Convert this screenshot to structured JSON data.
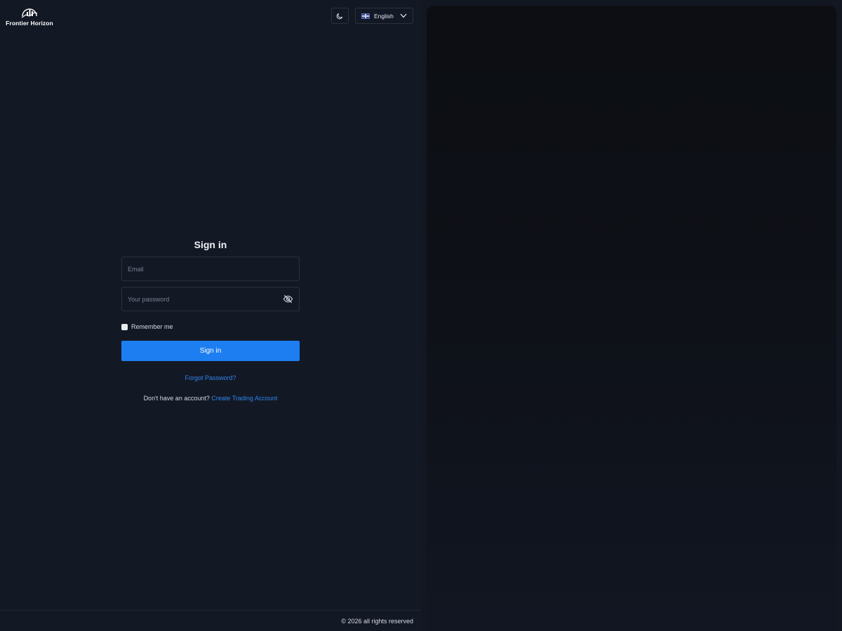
{
  "brand": {
    "name": "Frontier Horizon"
  },
  "header": {
    "theme_icon": "moon-icon",
    "language": {
      "selected": "English",
      "flag_icon": "uk-flag-icon",
      "chevron_icon": "chevron-down-icon"
    }
  },
  "form": {
    "title": "Sign in",
    "email_placeholder": "Email",
    "password_placeholder": "Your password",
    "password_toggle_icon": "eye-off-icon",
    "remember_label": "Remember me",
    "submit_label": "Sign in",
    "forgot_label": "Forgot Password?",
    "no_account_text": "Don't have an account?",
    "create_account_label": "Create Trading Account"
  },
  "footer": {
    "copyright": "© 2026 all rights reserved"
  },
  "colors": {
    "background": "#131825",
    "primary_button": "#1c7ef0",
    "link": "#2f86ea",
    "right_panel": "#0c0e13"
  }
}
